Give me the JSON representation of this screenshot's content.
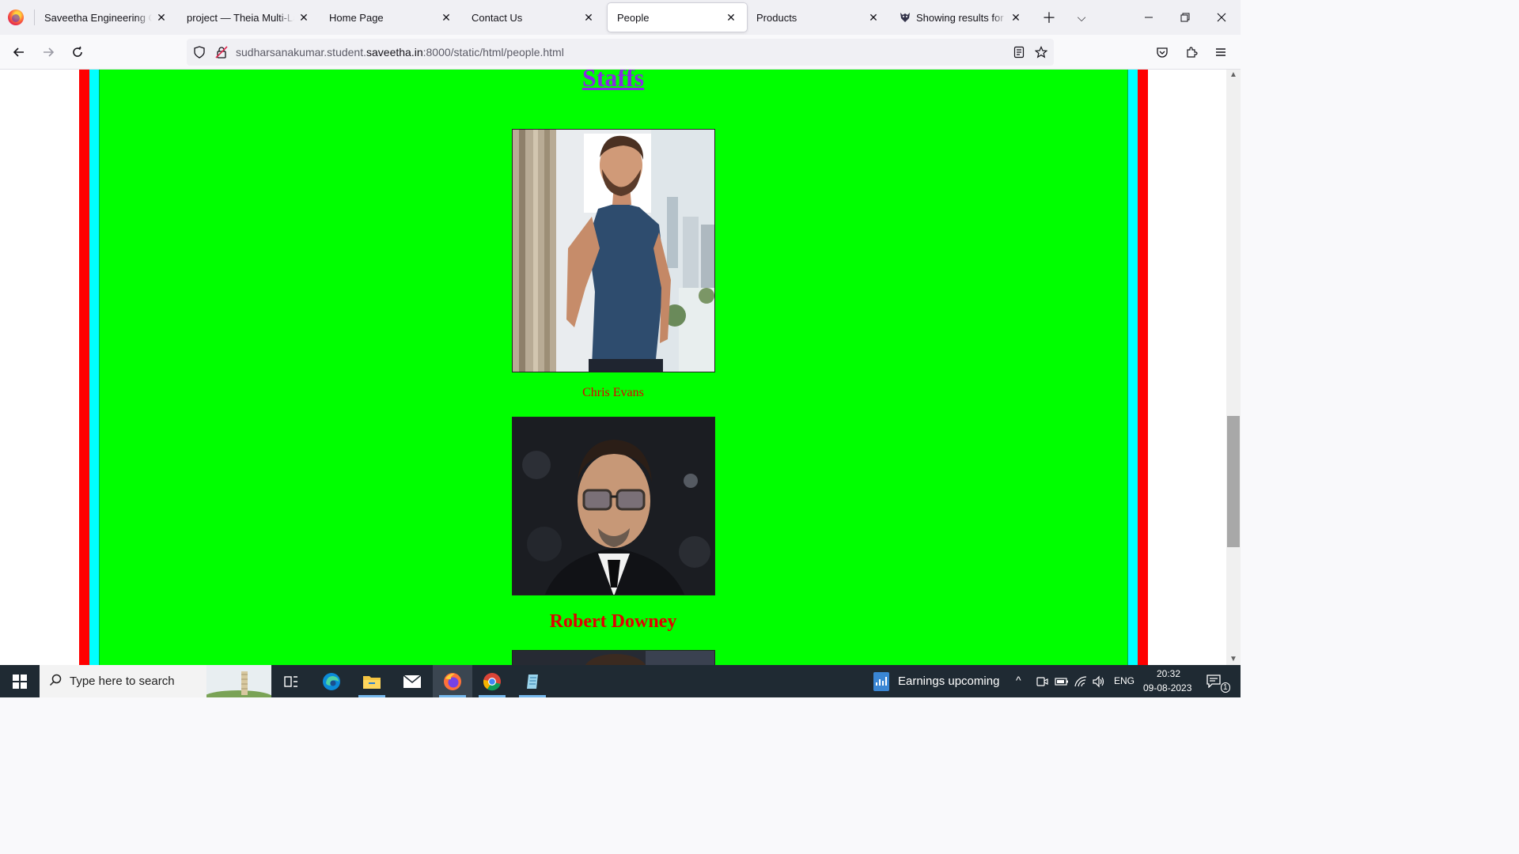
{
  "browser": {
    "tabs": [
      {
        "label": "Saveetha Engineering College",
        "active": false
      },
      {
        "label": "project — Theia Multi-Language Example",
        "active": false
      },
      {
        "label": "Home Page",
        "active": false
      },
      {
        "label": "Contact Us",
        "active": false
      },
      {
        "label": "People",
        "active": true
      },
      {
        "label": "Products",
        "active": false
      },
      {
        "label": "Showing results for https",
        "active": false
      }
    ],
    "url": {
      "prefix": "sudharsanakumar.student.",
      "host": "saveetha.in",
      "suffix": ":8000/static/html/people.html"
    }
  },
  "page": {
    "heading": "Staffs",
    "people": [
      {
        "caption": "Chris Evans"
      },
      {
        "caption": "Robert Downey"
      }
    ],
    "colors": {
      "outer_border": "#ff0000",
      "inner_border": "#00ffff",
      "background": "#00ff00",
      "heading": "#8a2be2",
      "caption": "#e00000"
    }
  },
  "taskbar": {
    "search_placeholder": "Type here to search",
    "widget_text": "Earnings upcoming",
    "language": "ENG",
    "time": "20:32",
    "date": "09-08-2023",
    "notification_count": "1"
  }
}
